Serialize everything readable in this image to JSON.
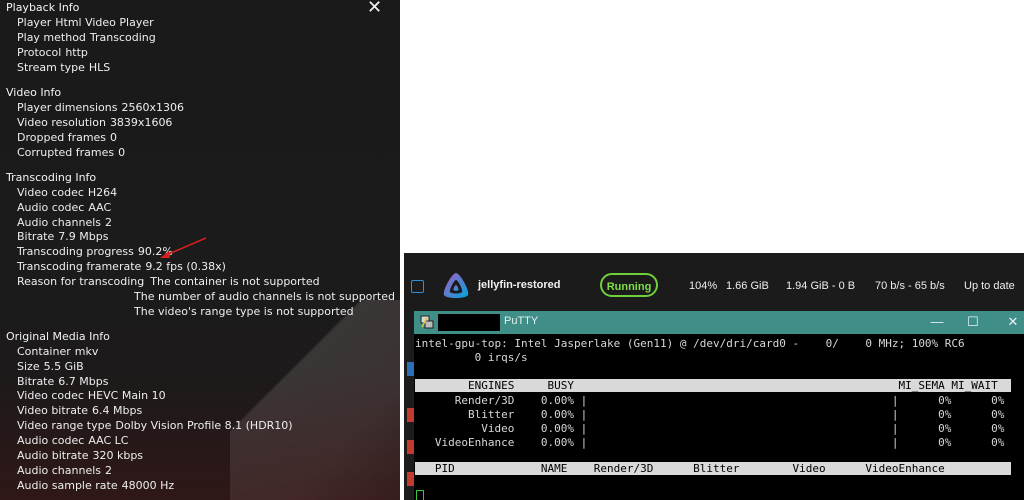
{
  "overlay": {
    "close_icon": "close-icon",
    "sections": {
      "playback": {
        "title": "Playback Info",
        "rows": [
          {
            "label": "Player",
            "value": "Html Video Player"
          },
          {
            "label": "Play method",
            "value": "Transcoding"
          },
          {
            "label": "Protocol",
            "value": "http"
          },
          {
            "label": "Stream type",
            "value": "HLS"
          }
        ]
      },
      "video": {
        "title": "Video Info",
        "rows": [
          {
            "label": "Player dimensions",
            "value": "2560x1306"
          },
          {
            "label": "Video resolution",
            "value": "3839x1606"
          },
          {
            "label": "Dropped frames",
            "value": "0"
          },
          {
            "label": "Corrupted frames",
            "value": "0"
          }
        ]
      },
      "transcoding": {
        "title": "Transcoding Info",
        "rows": [
          {
            "label": "Video codec",
            "value": "H264"
          },
          {
            "label": "Audio codec",
            "value": "AAC"
          },
          {
            "label": "Audio channels",
            "value": "2"
          },
          {
            "label": "Bitrate",
            "value": "7.9 Mbps"
          },
          {
            "label": "Transcoding progress",
            "value": "90.2%"
          },
          {
            "label": "Transcoding framerate",
            "value": "9.2 fps (0.38x)"
          },
          {
            "label": "Reason for transcoding",
            "value": "The container is not supported"
          }
        ],
        "reason_extra": [
          "The number of audio channels is not supported",
          "The video's range type is not supported"
        ]
      },
      "original": {
        "title": "Original Media Info",
        "rows": [
          {
            "label": "Container",
            "value": "mkv"
          },
          {
            "label": "Size",
            "value": "5.5 GiB"
          },
          {
            "label": "Bitrate",
            "value": "6.7 Mbps"
          },
          {
            "label": "Video codec",
            "value": "HEVC Main 10"
          },
          {
            "label": "Video bitrate",
            "value": "6.4 Mbps"
          },
          {
            "label": "Video range type",
            "value": "Dolby Vision Profile 8.1 (HDR10)"
          },
          {
            "label": "Audio codec",
            "value": "AAC LC"
          },
          {
            "label": "Audio bitrate",
            "value": "320 kbps"
          },
          {
            "label": "Audio channels",
            "value": "2"
          },
          {
            "label": "Audio sample rate",
            "value": "48000 Hz"
          }
        ]
      }
    }
  },
  "container": {
    "name": "jellyfin-restored",
    "status": "Running",
    "cpu": "104%",
    "memory": "1.66 GiB",
    "block_io": "1.94 GiB - 0 B",
    "net_io": "70 b/s - 65 b/s",
    "update": "Up to date"
  },
  "putty": {
    "title": "PuTTY",
    "buttons": {
      "minimize": "—",
      "maximize": "☐",
      "close": "✕"
    },
    "lines": [
      "intel-gpu-top: Intel Jasperlake (Gen11) @ /dev/dri/card0 -    0/    0 MHz; 100% RC6",
      "         0 irqs/s"
    ],
    "engines_header": "        ENGINES     BUSY                                                 MI_SEMA MI_WAIT",
    "engines": [
      "      Render/3D    0.00% |                                              |      0%      0%",
      "        Blitter    0.00% |                                              |      0%      0%",
      "          Video    0.00% |                                              |      0%      0%",
      "   VideoEnhance    0.00% |                                              |      0%      0%"
    ],
    "clients_header": "   PID             NAME    Render/3D      Blitter        Video      VideoEnhance"
  }
}
